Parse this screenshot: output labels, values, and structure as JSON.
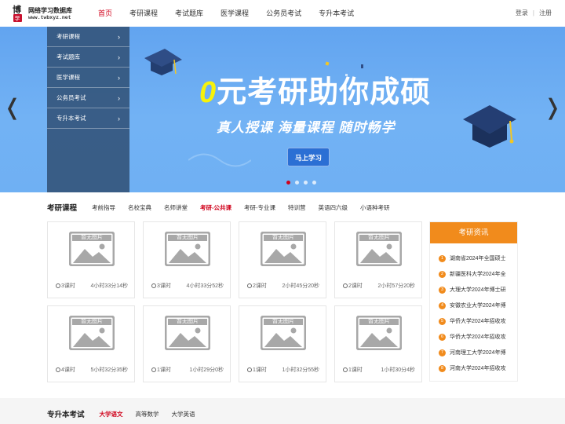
{
  "header": {
    "logo_title": "网络学习数据库",
    "logo_url": "www.twbxyz.net",
    "nav": [
      "首页",
      "考研课程",
      "考试题库",
      "医学课程",
      "公务员考试",
      "专升本考试"
    ],
    "active_nav": 0,
    "login_label": "登录",
    "separator": "|",
    "register_label": "注册"
  },
  "banner": {
    "side_menu": [
      "考研课程",
      "考试题库",
      "医学课程",
      "公务员考试",
      "专升本考试"
    ],
    "headline_zero": "0",
    "headline_rest": "元考研助你成硕",
    "subline": "真人授课 海量课程 随时畅学",
    "cta_label": "马上学习",
    "slide_count": 4,
    "active_slide": 0,
    "prev_glyph": "❬",
    "next_glyph": "❭"
  },
  "courses": {
    "title": "考研课程",
    "tabs": [
      "考前指导",
      "名校宝典",
      "名师讲堂",
      "考研-公共课",
      "考研-专业课",
      "特训营",
      "英语四六级",
      "小语种考研"
    ],
    "active_tab": 3,
    "placeholder_label": "暂无图片",
    "cards": [
      {
        "lessons": "3课时",
        "duration": "4小时33分14秒"
      },
      {
        "lessons": "3课时",
        "duration": "4小时33分52秒"
      },
      {
        "lessons": "2课时",
        "duration": "2小时45分20秒"
      },
      {
        "lessons": "2课时",
        "duration": "2小时57分20秒"
      },
      {
        "lessons": "4课时",
        "duration": "5小时32分35秒"
      },
      {
        "lessons": "1课时",
        "duration": "1小时29分0秒"
      },
      {
        "lessons": "1课时",
        "duration": "1小时32分55秒"
      },
      {
        "lessons": "1课时",
        "duration": "1小时30分4秒"
      }
    ]
  },
  "news": {
    "title": "考研资讯",
    "items": [
      "湖南省2024年全国硕士",
      "新疆医科大学2024年全",
      "大理大学2024年博士研",
      "安徽农业大学2024年博",
      "华侨大学2024年招收攻",
      "华侨大学2024年招收攻",
      "河南理工大学2024年博",
      "河南大学2024年招收攻"
    ]
  },
  "bottom_section": {
    "title": "专升本考试",
    "tabs": [
      "大学语文",
      "高等数学",
      "大学英语"
    ],
    "active_tab": 0
  },
  "colors": {
    "accent_red": "#d0021b",
    "news_orange": "#f18b1c",
    "banner_blue": "#6aaaf2",
    "side_menu_bg": "#34567d"
  }
}
